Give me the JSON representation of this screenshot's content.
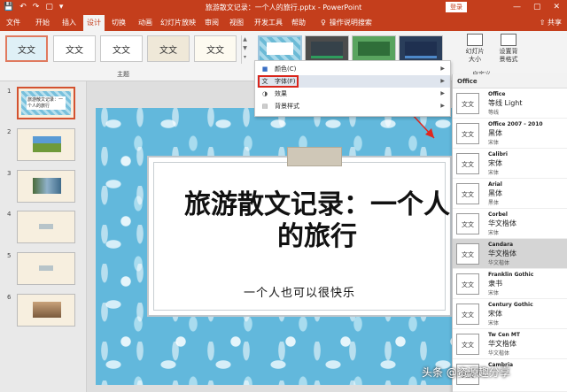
{
  "titlebar": {
    "title": "旅游散文记录：一个人的旅行.pptx - PowerPoint",
    "login": "登录",
    "qat": [
      "💾",
      "↶",
      "↷",
      "▢",
      "▾"
    ],
    "controls": [
      "—",
      "▢",
      "✕"
    ]
  },
  "tabs": [
    "文件",
    "开始",
    "插入",
    "设计",
    "切换",
    "动画",
    "幻灯片放映",
    "审阅",
    "视图",
    "开发工具",
    "帮助"
  ],
  "active_tab": "设计",
  "tell_me": "操作说明搜索",
  "share": "共享",
  "ribbon": {
    "themes": [
      "文文",
      "文文",
      "文文",
      "文文",
      "文文"
    ],
    "themes_label": "主题",
    "slide_size": "幻灯片\n大小",
    "format_bg": "设置背\n景格式",
    "customize_label": "自定义"
  },
  "slides": [
    {
      "num": "1",
      "text": "旅游散文记录：一个人的旅行"
    },
    {
      "num": "2"
    },
    {
      "num": "3"
    },
    {
      "num": "4"
    },
    {
      "num": "5"
    },
    {
      "num": "6"
    }
  ],
  "slide": {
    "title_line1": "旅游散文记录：一个人",
    "title_line2": "的旅行",
    "subtitle": "一个人也可以很快乐"
  },
  "variant_menu": [
    {
      "icon": "■",
      "label": "颜色(C)"
    },
    {
      "icon": "文",
      "label": "字体(F)"
    },
    {
      "icon": "◑",
      "label": "效果"
    },
    {
      "icon": "▤",
      "label": "背景样式"
    }
  ],
  "fonts_panel": {
    "header": "Office",
    "items": [
      {
        "name": "Office",
        "heading": "等线 Light",
        "body": "等线"
      },
      {
        "name": "Office 2007 - 2010",
        "heading": "黑体",
        "body": "宋体"
      },
      {
        "name": "Calibri",
        "heading": "宋体",
        "body": "宋体"
      },
      {
        "name": "Arial",
        "heading": "黑体",
        "body": "黑体"
      },
      {
        "name": "Corbel",
        "heading": "华文楷体",
        "body": "宋体"
      },
      {
        "name": "Candara",
        "heading": "华文楷体",
        "body": "华文楷体"
      },
      {
        "name": "Franklin Gothic",
        "heading": "隶书",
        "body": "宋体"
      },
      {
        "name": "Century Gothic",
        "heading": "宋体",
        "body": "宋体"
      },
      {
        "name": "Tw Cen MT",
        "heading": "华文楷体",
        "body": "华文楷体"
      },
      {
        "name": "Cambria",
        "heading": "",
        "body": ""
      }
    ],
    "icon_text": "文文"
  },
  "watermark": "头条 @资源趣分享",
  "colors": {
    "accent": "#c43e1c",
    "highlight_box": "#d9261c"
  }
}
